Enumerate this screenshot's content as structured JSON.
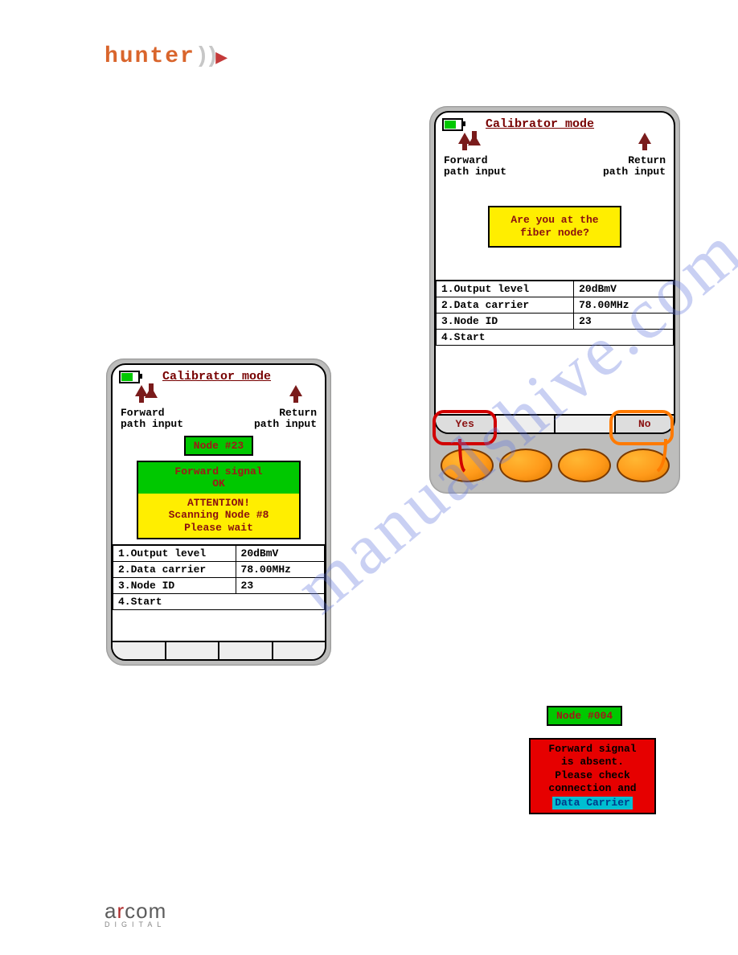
{
  "logo_top": {
    "text": "hunter",
    "swoosh": "))",
    "arrow": "▶"
  },
  "watermark": "manualshive.com",
  "device_left": {
    "title": "Calibrator mode",
    "fwd_label_l1": "Forward",
    "fwd_label_l2": "path input",
    "ret_label_l1": "Return",
    "ret_label_l2": "path input",
    "node_pill": "Node #23",
    "msg_seg1_l1": "Forward signal",
    "msg_seg1_l2": "OK",
    "msg_seg2_l1": "ATTENTION!",
    "msg_seg2_l2": "Scanning Node #8",
    "msg_seg2_l3": "Please wait",
    "rows": [
      {
        "k": "1.Output level",
        "v": "20dBmV"
      },
      {
        "k": "2.Data carrier",
        "v": "78.00MHz"
      },
      {
        "k": "3.Node ID",
        "v": "23"
      },
      {
        "k": "4.Start",
        "v": ""
      }
    ]
  },
  "device_right": {
    "title": "Calibrator mode",
    "fwd_label_l1": "Forward",
    "fwd_label_l2": "path input",
    "ret_label_l1": "Return",
    "ret_label_l2": "path input",
    "prompt_l1": "Are you at the",
    "prompt_l2": "fiber node?",
    "rows": [
      {
        "k": "1.Output level",
        "v": "20dBmV"
      },
      {
        "k": "2.Data carrier",
        "v": "78.00MHz"
      },
      {
        "k": "3.Node ID",
        "v": "23"
      },
      {
        "k": "4.Start",
        "v": ""
      }
    ],
    "softkeys": {
      "yes": "Yes",
      "no": "No"
    }
  },
  "error_panel": {
    "node_pill": "Node #004",
    "l1": "Forward signal",
    "l2": "is absent.",
    "l3": "Please check",
    "l4": "connection and",
    "dc": "Data Carrier"
  },
  "logo_bot": {
    "a": "a",
    "r": "r",
    "rest": "com",
    "sub": "DIGITAL"
  }
}
